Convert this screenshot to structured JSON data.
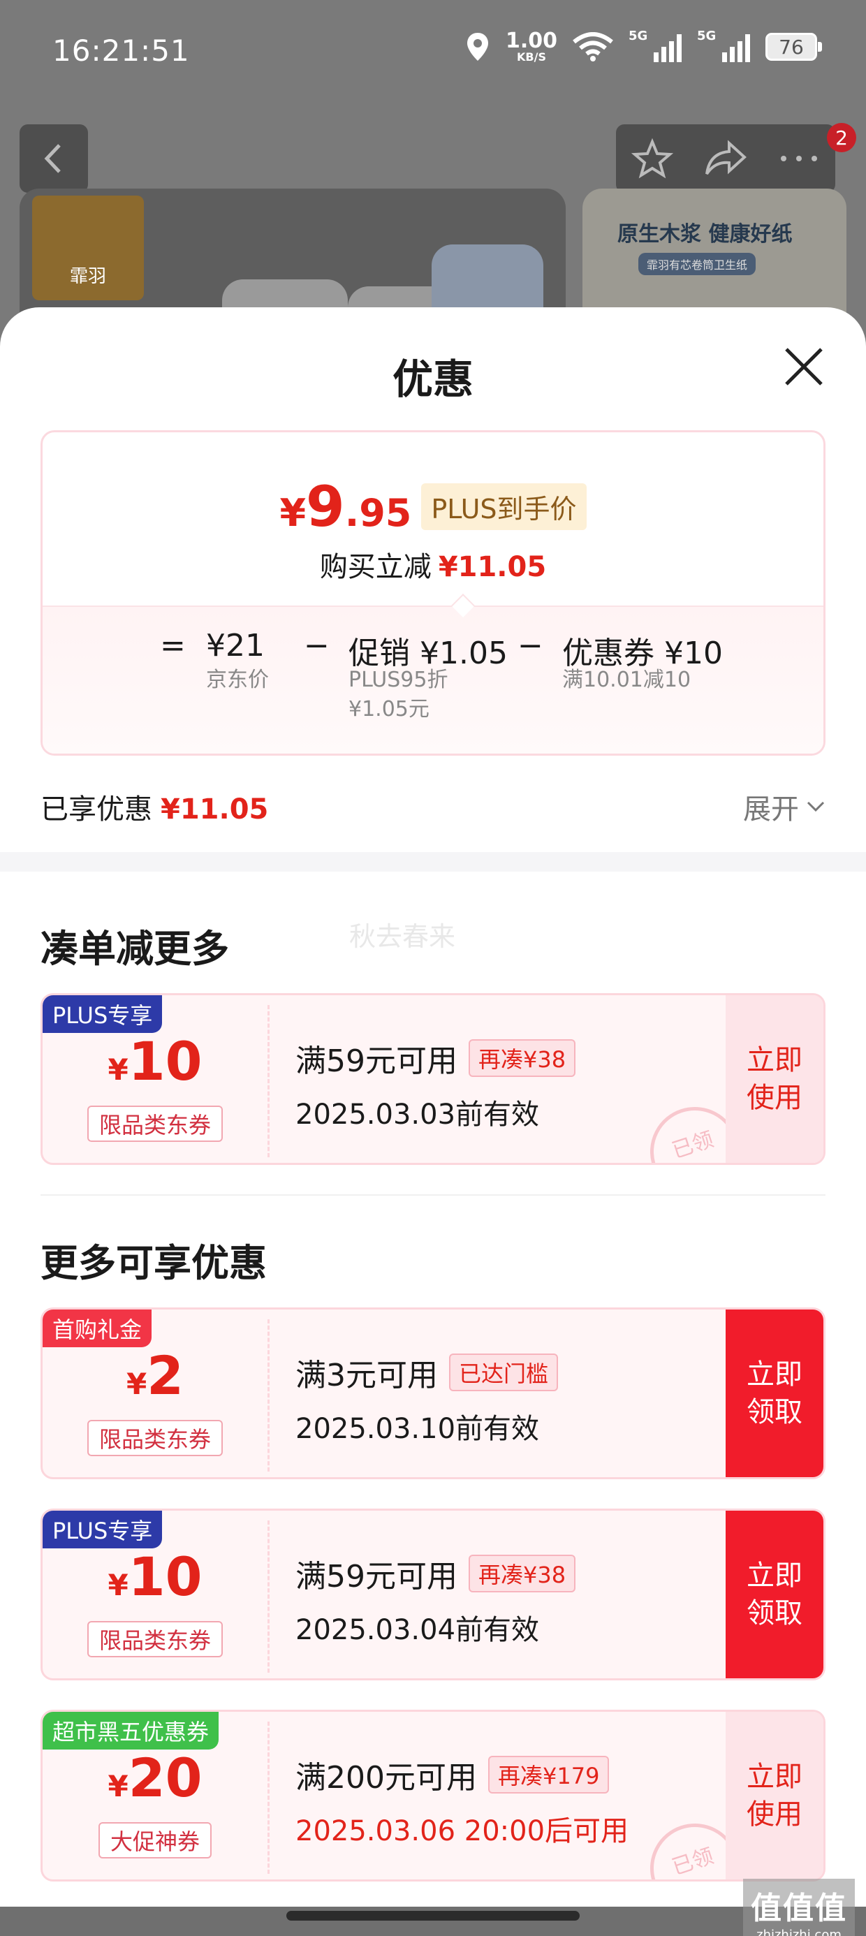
{
  "status_bar": {
    "time": "16:21:51",
    "net_speed_value": "1.00",
    "net_speed_unit": "KB/S",
    "signal_label": "5G",
    "battery": "76"
  },
  "product_header": {
    "cart_badge": "2",
    "logo_text": "霏羽",
    "slogan": "原生木浆 健康好纸",
    "slogan_sub": "霏羽有芯卷筒卫生纸"
  },
  "sheet": {
    "title": "优惠",
    "price": {
      "currency": "¥",
      "value_int": "9",
      "value_dec": ".95",
      "plus_tag": "PLUS到手价",
      "saving_label": "购买立减",
      "saving_value": "¥11.05"
    },
    "formula": {
      "equals": "=",
      "base_price": "¥21",
      "base_label": "京东价",
      "minus": "−",
      "promo": "促销 ¥1.05",
      "promo_note_1": "PLUS95折",
      "promo_note_2": "¥1.05元",
      "coupon": "优惠券 ¥10",
      "coupon_note": "满10.01减10"
    },
    "enjoyed_label": "已享优惠",
    "enjoyed_value": "¥11.05",
    "expand_label": "展开"
  },
  "section_more_orders": {
    "title": "凑单减更多",
    "faint_text": "秋去春来"
  },
  "section_more_offers": {
    "title": "更多可享优惠"
  },
  "coupons": [
    {
      "tag": "PLUS专享",
      "symbol": "¥",
      "amount": "10",
      "kind": "限品类东券",
      "condition": "满59元可用",
      "pill": "再凑¥38",
      "date": "2025.03.03前有效",
      "button": "立即\n使用",
      "stamp": "已领"
    },
    {
      "tag": "首购礼金",
      "symbol": "¥",
      "amount": "2",
      "kind": "限品类东券",
      "condition": "满3元可用",
      "pill": "已达门槛",
      "date": "2025.03.10前有效",
      "button": "立即\n领取"
    },
    {
      "tag": "PLUS专享",
      "symbol": "¥",
      "amount": "10",
      "kind": "限品类东券",
      "condition": "满59元可用",
      "pill": "再凑¥38",
      "date": "2025.03.04前有效",
      "button": "立即\n领取"
    },
    {
      "tag": "超市黑五优惠券",
      "symbol": "¥",
      "amount": "20",
      "kind": "大促神券",
      "condition": "满200元可用",
      "pill": "再凑¥179",
      "date": "2025.03.06 20:00后可用",
      "button": "立即\n使用",
      "stamp": "已领"
    }
  ],
  "watermark": {
    "logo": "值值值",
    "domain": "zhizhizhi.com"
  },
  "colors": {
    "accent_red": "#e2231a",
    "claim_button": "#f11c2b",
    "plus_tag": "#2d3aa8",
    "black_friday_tag": "#3fc04a"
  }
}
